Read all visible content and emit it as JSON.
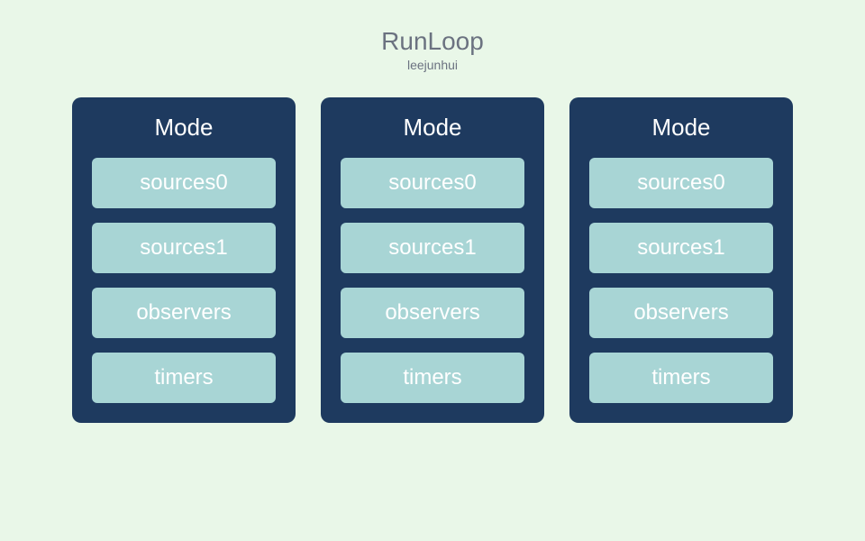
{
  "title": "RunLoop",
  "subtitle": "leejunhui",
  "modes": [
    {
      "label": "Mode",
      "items": [
        "sources0",
        "sources1",
        "observers",
        "timers"
      ]
    },
    {
      "label": "Mode",
      "items": [
        "sources0",
        "sources1",
        "observers",
        "timers"
      ]
    },
    {
      "label": "Mode",
      "items": [
        "sources0",
        "sources1",
        "observers",
        "timers"
      ]
    }
  ]
}
